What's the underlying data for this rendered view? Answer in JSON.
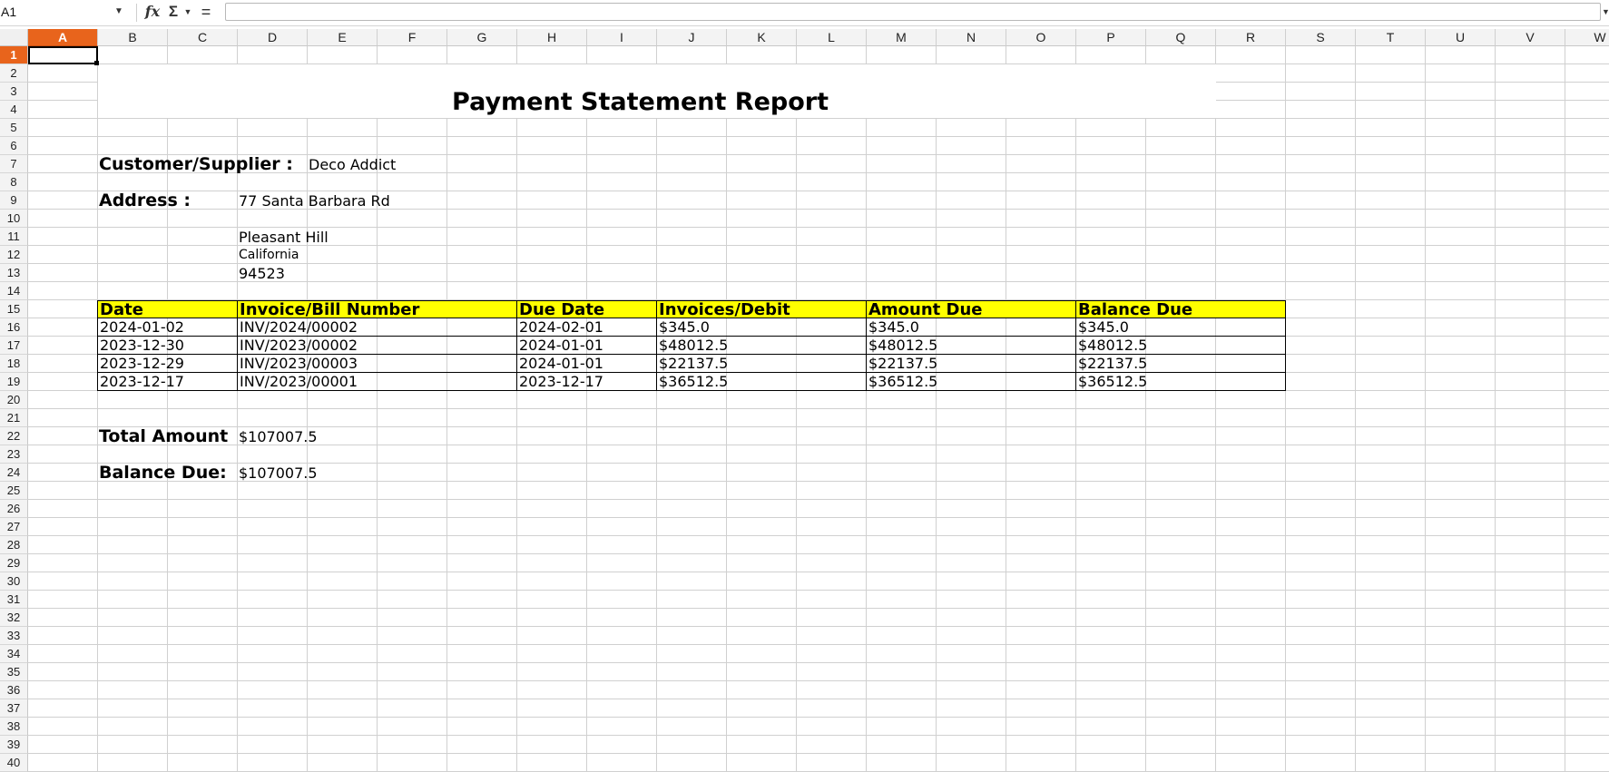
{
  "formula_bar": {
    "cell_ref": "A1",
    "formula_value": "",
    "fx_label": "fx",
    "sum_label": "Σ",
    "equals_label": "="
  },
  "columns": [
    "A",
    "B",
    "C",
    "D",
    "E",
    "F",
    "G",
    "H",
    "I",
    "J",
    "K",
    "L",
    "M",
    "N",
    "O",
    "P",
    "Q",
    "R",
    "S",
    "T",
    "U",
    "V",
    "W"
  ],
  "active_column": "A",
  "rows": [
    "1",
    "2",
    "3",
    "4",
    "5",
    "6",
    "7",
    "8",
    "9",
    "10",
    "11",
    "12",
    "13",
    "14",
    "15",
    "16",
    "17",
    "18",
    "19",
    "20",
    "21",
    "22",
    "23",
    "24",
    "25",
    "26",
    "27",
    "28",
    "29",
    "30",
    "31",
    "32",
    "33",
    "34",
    "35",
    "36",
    "37",
    "38",
    "39",
    "40"
  ],
  "active_row": "1",
  "report": {
    "title": "Payment Statement Report",
    "customer_label": "Customer/Supplier :",
    "customer_value": "Deco Addict",
    "address_label": "Address :",
    "address_line1": "77 Santa Barbara Rd",
    "address_city": "Pleasant Hill",
    "address_state": "California",
    "address_zip": "94523",
    "table": {
      "headers": [
        "Date",
        "Invoice/Bill Number",
        "Due Date",
        "Invoices/Debit",
        "Amount Due",
        "Balance Due"
      ],
      "rows": [
        [
          "2024-01-02",
          "INV/2024/00002",
          "2024-02-01",
          "$345.0",
          "$345.0",
          "$345.0"
        ],
        [
          "2023-12-30",
          "INV/2023/00002",
          "2024-01-01",
          "$48012.5",
          "$48012.5",
          "$48012.5"
        ],
        [
          "2023-12-29",
          "INV/2023/00003",
          "2024-01-01",
          "$22137.5",
          "$22137.5",
          "$22137.5"
        ],
        [
          "2023-12-17",
          "INV/2023/00001",
          "2023-12-17",
          "$36512.5",
          "$36512.5",
          "$36512.5"
        ]
      ]
    },
    "total_label": "Total Amount",
    "total_value": "$107007.5",
    "balance_label": "Balance Due:",
    "balance_value": "$107007.5"
  }
}
